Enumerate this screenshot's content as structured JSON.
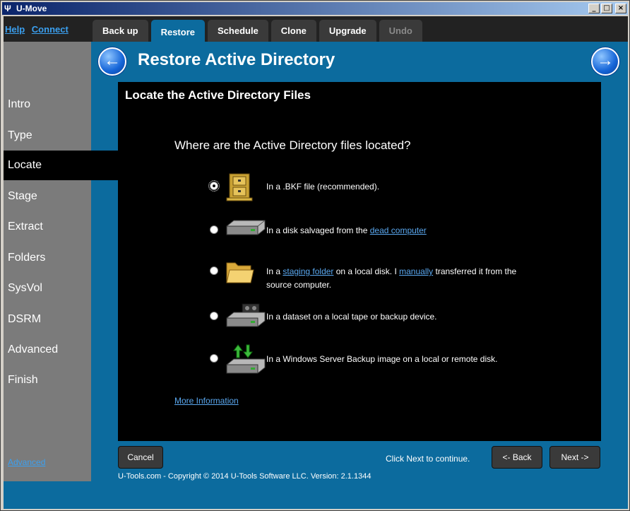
{
  "window": {
    "title": "U-Move",
    "min": "_",
    "max": "□",
    "close": "×"
  },
  "toplinks": {
    "help": "Help",
    "connect": "Connect"
  },
  "tabs": [
    {
      "label": "Back up",
      "state": "normal"
    },
    {
      "label": "Restore",
      "state": "active"
    },
    {
      "label": "Schedule",
      "state": "normal"
    },
    {
      "label": "Clone",
      "state": "normal"
    },
    {
      "label": "Upgrade",
      "state": "normal"
    },
    {
      "label": "Undo",
      "state": "disabled"
    }
  ],
  "sidebar": {
    "items": [
      "Intro",
      "Type",
      "Locate",
      "Stage",
      "Extract",
      "Folders",
      "SysVol",
      "DSRM",
      "Advanced",
      "Finish"
    ],
    "active": "Locate",
    "advanced_link": "Advanced"
  },
  "header": {
    "title": "Restore Active Directory"
  },
  "panel": {
    "title": "Locate the Active Directory Files",
    "question": "Where are the Active Directory files located?",
    "options": [
      {
        "icon": "archive-cabinet-icon",
        "text": "In a .BKF file (recommended).",
        "checked": true
      },
      {
        "icon": "hard-disk-icon",
        "text_pre": "In a disk salvaged from the ",
        "link": "dead computer",
        "checked": false
      },
      {
        "icon": "folder-icon",
        "text_pre": "In a ",
        "link1": "staging folder",
        "text_mid": " on a local disk. I ",
        "link2": "manually",
        "text_post": " transferred it from the source computer.",
        "checked": false
      },
      {
        "icon": "tape-drive-icon",
        "text": "In a dataset on a local tape or backup device.",
        "checked": false
      },
      {
        "icon": "server-backup-icon",
        "text": "In a Windows Server Backup image on a local or remote disk.",
        "checked": false
      }
    ],
    "more_info": "More Information"
  },
  "buttons": {
    "cancel": "Cancel",
    "back": "<- Back",
    "next": "Next ->"
  },
  "hint": "Click Next to continue.",
  "footer": "U-Tools.com - Copyright © 2014 U-Tools Software LLC.    Version: 2.1.1344",
  "colors": {
    "accent": "#0c6b9e",
    "link": "#5aa8f0",
    "panel": "#000000"
  }
}
